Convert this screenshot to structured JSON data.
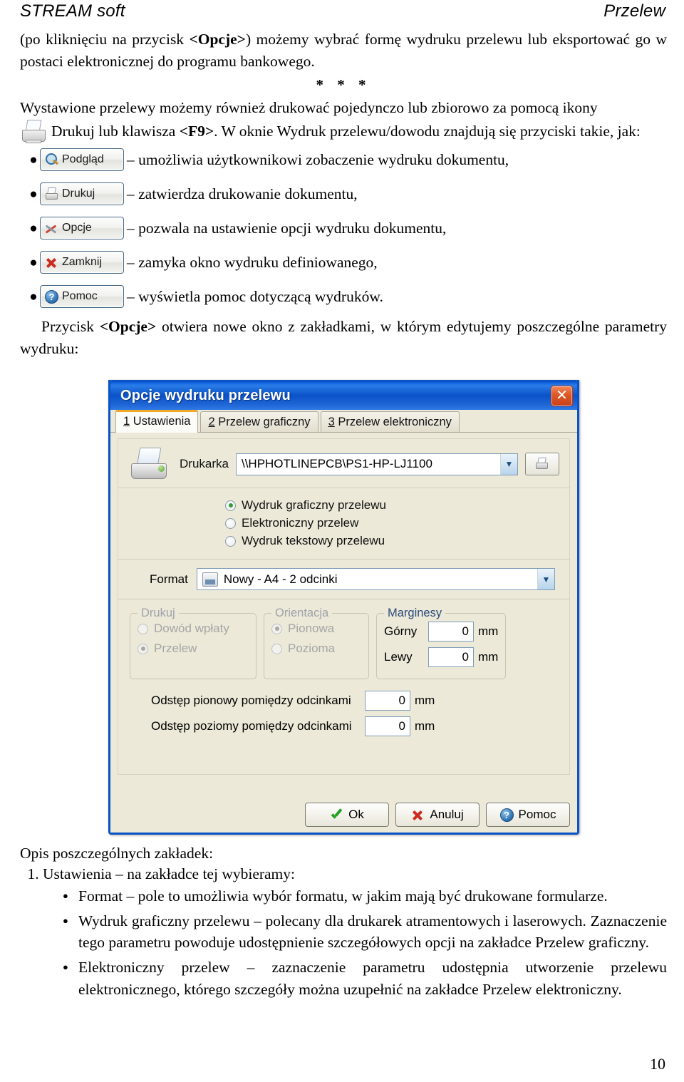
{
  "header": {
    "left": "STREAM soft",
    "right": "Przelew"
  },
  "intro": {
    "para1_a": "(po kliknięciu na przycisk ",
    "para1_b": "<Opcje>",
    "para1_c": ") możemy wybrać formę wydruku przelewu lub eksportować go w postaci elektronicznej do programu bankowego.",
    "stars": "* * *",
    "para2_a": "Wystawione przelewy możemy również drukować pojedynczo lub zbiorowo za pomocą ikony",
    "para2_b": "Drukuj lub klawisza ",
    "para2_key": "<F9>",
    "para2_c": ". W oknie Wydruk przelewu/dowodu znajdują się przyciski takie, jak:"
  },
  "buttons": [
    {
      "icon": "magnifier-icon",
      "label": "Podgląd",
      "underline": "",
      "desc": "– umożliwia użytkownikowi zobaczenie wydruku dokumentu,"
    },
    {
      "icon": "printer-icon",
      "label": "Drukuj",
      "underline": "D",
      "desc": "– zatwierdza drukowanie dokumentu,"
    },
    {
      "icon": "tools-icon",
      "label": "Opcje",
      "underline": "",
      "desc": "– pozwala na ustawienie opcji wydruku dokumentu,"
    },
    {
      "icon": "red-x-icon",
      "label": "Zamknij",
      "underline": "Z",
      "desc": "– zamyka okno wydruku definiowanego,"
    },
    {
      "icon": "help-icon",
      "label": "Pomoc",
      "underline": "",
      "desc": "– wyświetla pomoc dotyczącą wydruków."
    }
  ],
  "after_buttons": {
    "text_a": "Przycisk ",
    "text_b": "<Opcje>",
    "text_c": " otwiera nowe okno z zakładkami, w którym edytujemy poszczególne parametry wydruku:"
  },
  "dialog": {
    "title": "Opcje wydruku przelewu",
    "close_label": "✕",
    "tabs": [
      {
        "num": "1",
        "label": " Ustawienia",
        "active": true
      },
      {
        "num": "2",
        "label": " Przelew graficzny",
        "active": false
      },
      {
        "num": "3",
        "label": " Przelew elektroniczny",
        "active": false
      }
    ],
    "printer": {
      "label": "Drukarka",
      "value": "\\\\HPHOTLINEPCB\\PS1-HP-LJ1100"
    },
    "print_mode": {
      "options": [
        {
          "label": "Wydruk graficzny przelewu",
          "selected": true
        },
        {
          "label": "Elektroniczny przelew",
          "selected": false
        },
        {
          "label": "Wydruk tekstowy przelewu",
          "selected": false
        }
      ]
    },
    "format": {
      "label": "Format",
      "value": "Nowy - A4 - 2 odcinki"
    },
    "group_drukuj": {
      "legend": "Drukuj",
      "disabled": true,
      "options": [
        {
          "label": "Dowód wpłaty",
          "selected": false
        },
        {
          "label": "Przelew",
          "selected": true
        }
      ]
    },
    "group_orientacja": {
      "legend": "Orientacja",
      "disabled": true,
      "options": [
        {
          "label": "Pionowa",
          "selected": true
        },
        {
          "label": "Pozioma",
          "selected": false
        }
      ]
    },
    "group_marginesy": {
      "legend": "Marginesy",
      "fields": [
        {
          "label": "Górny",
          "value": "0",
          "unit": "mm"
        },
        {
          "label": "Lewy",
          "value": "0",
          "unit": "mm"
        }
      ]
    },
    "spacing": [
      {
        "label": "Odstęp pionowy pomiędzy odcinkami",
        "value": "0",
        "unit": "mm"
      },
      {
        "label": "Odstęp poziomy pomiędzy odcinkami",
        "value": "0",
        "unit": "mm"
      }
    ],
    "footer_buttons": [
      {
        "icon": "green-check-icon",
        "label_pre": "O",
        "label_rest": "k",
        "full": "Ok"
      },
      {
        "icon": "red-x-icon",
        "label_pre": "A",
        "label_rest": "nuluj",
        "full": "Anuluj"
      },
      {
        "icon": "help-icon",
        "label_pre": "",
        "label_rest": "Pomoc",
        "full": "Pomoc"
      }
    ]
  },
  "lower": {
    "intro": "Opis poszczególnych zakładek:",
    "item1": "Ustawienia – na zakładce tej wybieramy:",
    "sub": [
      "Format – pole to umożliwia wybór formatu, w jakim mają być drukowane formularze.",
      "Wydruk graficzny przelewu – polecany dla drukarek atramentowych i laserowych. Zaznaczenie tego parametru powoduje udostępnienie szczegółowych opcji na zakładce Przelew graficzny.",
      "Elektroniczny przelew – zaznaczenie parametru udostępnia utworzenie przelewu elektronicznego, którego szczegóły można uzupełnić na zakładce Przelew elektroniczny."
    ]
  },
  "page_number": "10"
}
